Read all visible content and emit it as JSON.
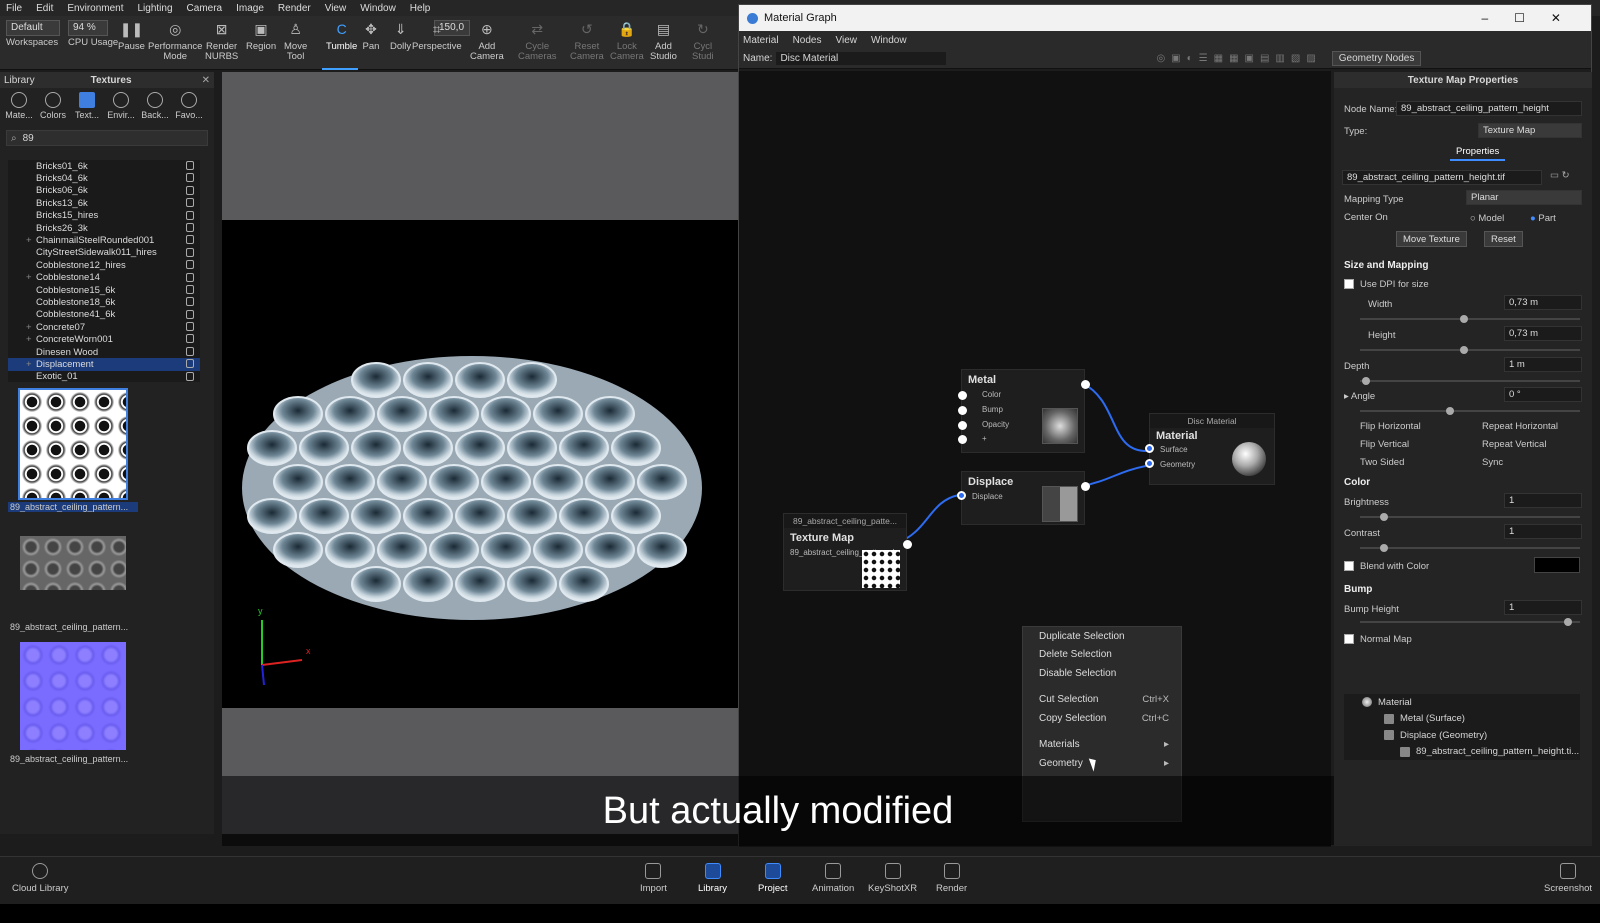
{
  "menubar": [
    "File",
    "Edit",
    "Environment",
    "Lighting",
    "Camera",
    "Image",
    "Render",
    "View",
    "Window",
    "Help"
  ],
  "toolbar": {
    "preset": "Default",
    "cpu": "94 %",
    "fov": "150,0",
    "items": [
      {
        "label": "Workspaces",
        "icon": "workspaces-icon"
      },
      {
        "label": "CPU Usage",
        "icon": "cpu-icon"
      },
      {
        "label": "Pause",
        "icon": "pause-icon"
      },
      {
        "label": "Performance\nMode",
        "icon": "performance-icon"
      },
      {
        "label": "Render\nNURBS",
        "icon": "nurbs-icon"
      },
      {
        "label": "Region",
        "icon": "region-icon"
      },
      {
        "label": "Move\nTool",
        "icon": "move-icon"
      },
      {
        "label": "Tumble",
        "icon": "tumble-icon"
      },
      {
        "label": "Pan",
        "icon": "pan-icon"
      },
      {
        "label": "Dolly",
        "icon": "dolly-icon"
      },
      {
        "label": "Perspective",
        "icon": "perspective-icon"
      },
      {
        "label": "Add\nCamera",
        "icon": "camera-icon"
      },
      {
        "label": "Cycle\nCameras",
        "icon": "cycle-icon"
      },
      {
        "label": "Reset\nCamera",
        "icon": "reset-icon"
      },
      {
        "label": "Lock\nCamera",
        "icon": "lock-icon"
      },
      {
        "label": "Add\nStudio",
        "icon": "studio-icon"
      },
      {
        "label": "Cycl\nStudi",
        "icon": "cycle-studio-icon"
      }
    ]
  },
  "library": {
    "title": "Library",
    "panel": "Textures",
    "tabs": [
      "Mate...",
      "Colors",
      "Text...",
      "Envir...",
      "Back...",
      "Favo..."
    ],
    "search": "89",
    "items": [
      "Bricks01_6k",
      "Bricks04_6k",
      "Bricks06_6k",
      "Bricks13_6k",
      "Bricks15_hires",
      "Bricks26_3k",
      "ChainmailSteelRounded001",
      "CityStreetSidewalk011_hires",
      "Cobblestone12_hires",
      "Cobblestone14",
      "Cobblestone15_6k",
      "Cobblestone18_6k",
      "Cobblestone41_6k",
      "Concrete07",
      "ConcreteWorn001",
      "Dinesen Wood",
      "Displacement",
      "Exotic_01"
    ],
    "selected": "Displacement",
    "thumbs": [
      "89_abstract_ceiling_pattern...",
      "89_abstract_ceiling_pattern...",
      "89_abstract_ceiling_pattern..."
    ]
  },
  "viewport": {
    "axes": [
      "y",
      "x"
    ]
  },
  "material_graph": {
    "window_title": "Material Graph",
    "menu": [
      "Material",
      "Nodes",
      "View",
      "Window"
    ],
    "name_label": "Name:",
    "name_value": "Disc Material",
    "geometry_nodes": "Geometry Nodes",
    "nodes": {
      "metal": {
        "title": "Metal",
        "pins": [
          "Color",
          "Bump",
          "Opacity",
          "+"
        ]
      },
      "displace": {
        "title": "Displace",
        "pins": [
          "Displace"
        ]
      },
      "texture": {
        "header": "89_abstract_ceiling_patte...",
        "title": "Texture Map",
        "sub": "89_abstract_ceiling_pattern_h"
      },
      "material": {
        "header": "Disc Material",
        "title": "Material",
        "pins": [
          "Surface",
          "Geometry"
        ]
      }
    },
    "context_menu": [
      {
        "label": "Duplicate Selection",
        "shortcut": ""
      },
      {
        "label": "Delete Selection",
        "shortcut": ""
      },
      {
        "label": "Disable Selection",
        "shortcut": ""
      },
      {
        "label": "Cut Selection",
        "shortcut": "Ctrl+X"
      },
      {
        "label": "Copy Selection",
        "shortcut": "Ctrl+C"
      },
      {
        "label": "Materials",
        "shortcut": "▸"
      },
      {
        "label": "Geometry",
        "shortcut": "▸"
      }
    ]
  },
  "properties": {
    "title": "Texture Map Properties",
    "node_name_label": "Node Name:",
    "node_name": "89_abstract_ceiling_pattern_height",
    "type_label": "Type:",
    "type": "Texture Map",
    "tab": "Properties",
    "file": "89_abstract_ceiling_pattern_height.tif",
    "mapping_type_label": "Mapping Type",
    "mapping_type": "Planar",
    "center_on_label": "Center On",
    "center_model": "Model",
    "center_part": "Part",
    "move_texture": "Move Texture",
    "reset": "Reset",
    "size_section": "Size and Mapping",
    "use_dpi": "Use DPI for size",
    "width_label": "Width",
    "width": "0,73 m",
    "height_label": "Height",
    "height": "0,73 m",
    "depth_label": "Depth",
    "depth": "1 m",
    "angle_label": "Angle",
    "angle": "0 °",
    "flip_h": "Flip Horizontal",
    "repeat_h": "Repeat Horizontal",
    "flip_v": "Flip Vertical",
    "repeat_v": "Repeat Vertical",
    "two_sided": "Two Sided",
    "sync": "Sync",
    "color_section": "Color",
    "brightness_label": "Brightness",
    "brightness": "1",
    "contrast_label": "Contrast",
    "contrast": "1",
    "blend_label": "Blend with Color",
    "bump_section": "Bump",
    "bump_height_label": "Bump Height",
    "bump_height": "1",
    "normal_map": "Normal Map",
    "tree": [
      "Material",
      "Metal (Surface)",
      "Displace (Geometry)",
      "89_abstract_ceiling_pattern_height.ti..."
    ]
  },
  "bottombar": {
    "left": "Cloud Library",
    "items": [
      "Import",
      "Library",
      "Project",
      "Animation",
      "KeyShotXR",
      "Render"
    ],
    "right": "Screenshot"
  },
  "subtitle": "But actually modified"
}
